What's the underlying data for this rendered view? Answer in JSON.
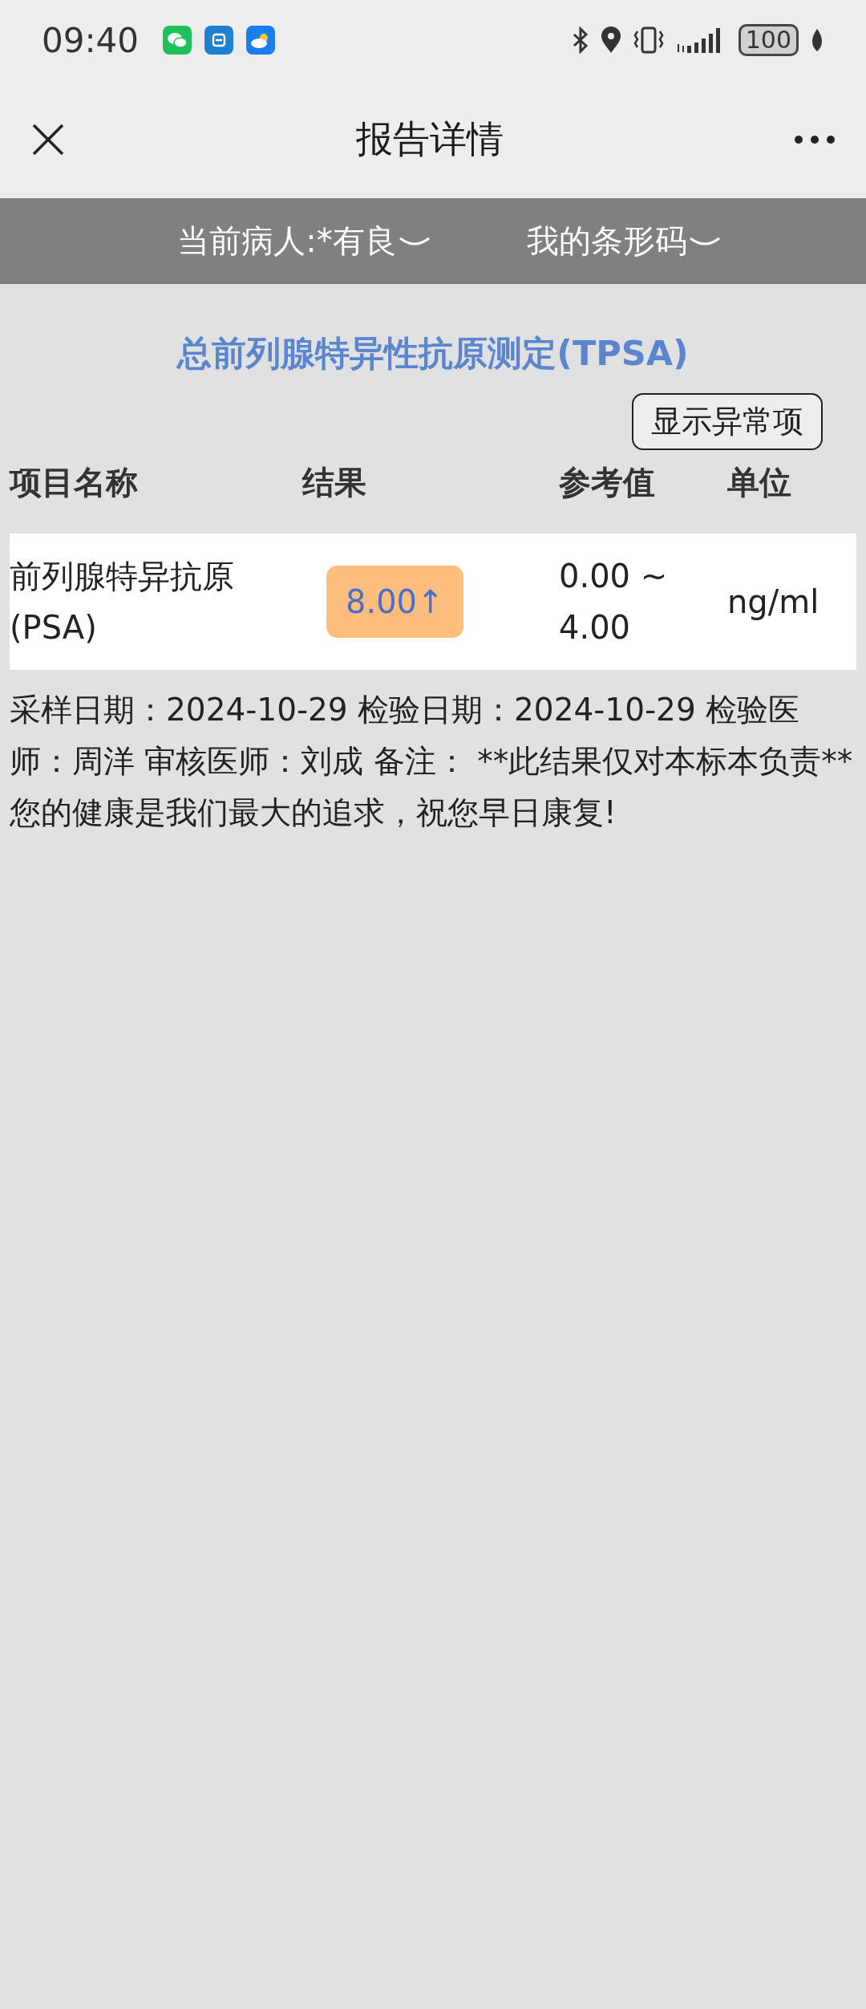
{
  "status_bar": {
    "time": "09:40",
    "battery": "100"
  },
  "nav": {
    "title": "报告详情"
  },
  "selectors": [
    {
      "label": "当前病人:*有良"
    },
    {
      "label": "我的条形码"
    }
  ],
  "report": {
    "title": "总前列腺特异性抗原测定(TPSA)",
    "filter_button": "显示异常项",
    "columns": [
      "项目名称",
      "结果",
      "参考值",
      "单位"
    ],
    "rows": [
      {
        "name": "前列腺特异抗原(PSA)",
        "result": "8.00↑",
        "abnormal": true,
        "reference": "0.00 ~ 4.00",
        "unit": "ng/ml"
      }
    ],
    "note": "采样日期：2024-10-29 检验日期：2024-10-29 检验医师：周洋 审核医师：刘成 备注： **此结果仅对本标本负责** 您的健康是我们最大的追求，祝您早日康复!"
  }
}
